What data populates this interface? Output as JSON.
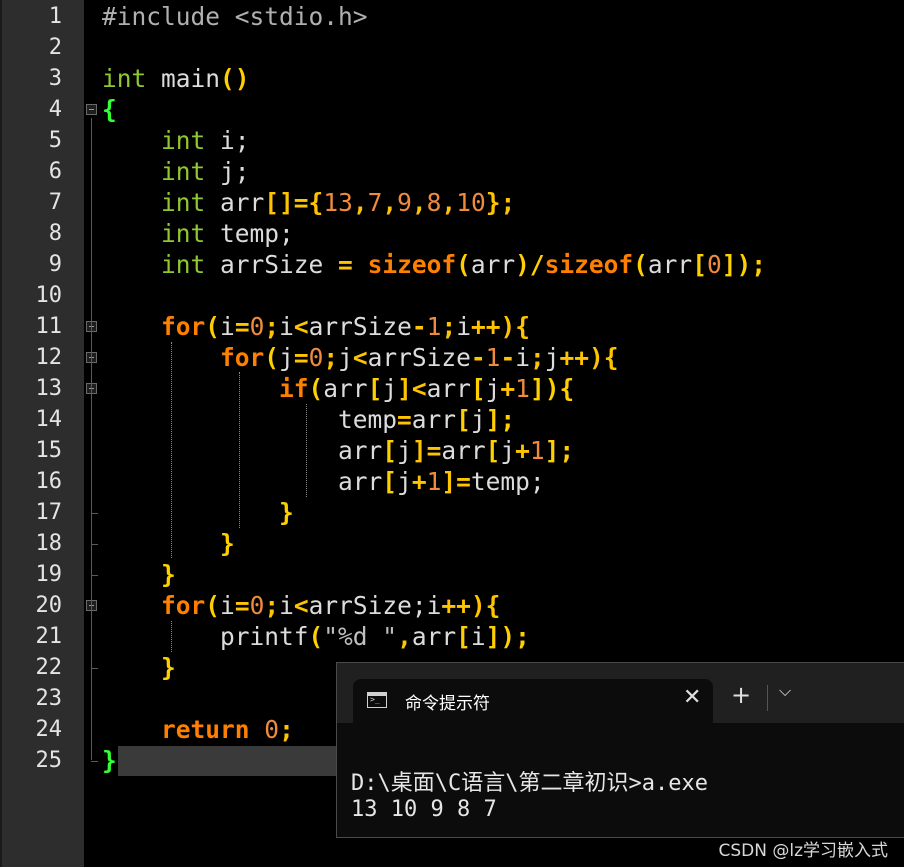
{
  "editor": {
    "line_numbers": [
      "1",
      "2",
      "3",
      "4",
      "5",
      "6",
      "7",
      "8",
      "9",
      "10",
      "11",
      "12",
      "13",
      "14",
      "15",
      "16",
      "17",
      "18",
      "19",
      "20",
      "21",
      "22",
      "23",
      "24",
      "25"
    ],
    "lines": [
      [
        {
          "t": "#include <stdio.h>",
          "c": "pre"
        }
      ],
      [],
      [
        {
          "t": "int",
          "c": "ty"
        },
        {
          "t": " main",
          "c": "id"
        },
        {
          "t": "()",
          "c": "br"
        }
      ],
      [
        {
          "t": "{",
          "c": "brace"
        }
      ],
      [
        {
          "t": "    ",
          "c": "id"
        },
        {
          "t": "int",
          "c": "ty"
        },
        {
          "t": " i;",
          "c": "id"
        }
      ],
      [
        {
          "t": "    ",
          "c": "id"
        },
        {
          "t": "int",
          "c": "ty"
        },
        {
          "t": " j;",
          "c": "id"
        }
      ],
      [
        {
          "t": "    ",
          "c": "id"
        },
        {
          "t": "int",
          "c": "ty"
        },
        {
          "t": " arr",
          "c": "id"
        },
        {
          "t": "[]={",
          "c": "op"
        },
        {
          "t": "13",
          "c": "num"
        },
        {
          "t": ",",
          "c": "op"
        },
        {
          "t": "7",
          "c": "num"
        },
        {
          "t": ",",
          "c": "op"
        },
        {
          "t": "9",
          "c": "num"
        },
        {
          "t": ",",
          "c": "op"
        },
        {
          "t": "8",
          "c": "num"
        },
        {
          "t": ",",
          "c": "op"
        },
        {
          "t": "10",
          "c": "num"
        },
        {
          "t": "};",
          "c": "op"
        }
      ],
      [
        {
          "t": "    ",
          "c": "id"
        },
        {
          "t": "int",
          "c": "ty"
        },
        {
          "t": " temp;",
          "c": "id"
        }
      ],
      [
        {
          "t": "    ",
          "c": "id"
        },
        {
          "t": "int",
          "c": "ty"
        },
        {
          "t": " arrSize ",
          "c": "id"
        },
        {
          "t": "=",
          "c": "op"
        },
        {
          "t": " ",
          "c": "id"
        },
        {
          "t": "sizeof",
          "c": "kw"
        },
        {
          "t": "(",
          "c": "br"
        },
        {
          "t": "arr",
          "c": "id"
        },
        {
          "t": ")/",
          "c": "br"
        },
        {
          "t": "sizeof",
          "c": "kw"
        },
        {
          "t": "(",
          "c": "br"
        },
        {
          "t": "arr",
          "c": "id"
        },
        {
          "t": "[",
          "c": "br"
        },
        {
          "t": "0",
          "c": "num"
        },
        {
          "t": "]);",
          "c": "br"
        }
      ],
      [],
      [
        {
          "t": "    ",
          "c": "id"
        },
        {
          "t": "for",
          "c": "kw"
        },
        {
          "t": "(",
          "c": "br"
        },
        {
          "t": "i",
          "c": "id"
        },
        {
          "t": "=",
          "c": "op"
        },
        {
          "t": "0",
          "c": "num"
        },
        {
          "t": ";",
          "c": "op"
        },
        {
          "t": "i",
          "c": "id"
        },
        {
          "t": "<",
          "c": "op"
        },
        {
          "t": "arrSize",
          "c": "id"
        },
        {
          "t": "-",
          "c": "op"
        },
        {
          "t": "1",
          "c": "num"
        },
        {
          "t": ";",
          "c": "op"
        },
        {
          "t": "i",
          "c": "id"
        },
        {
          "t": "++){",
          "c": "op"
        }
      ],
      [
        {
          "t": "        ",
          "c": "id"
        },
        {
          "t": "for",
          "c": "kw"
        },
        {
          "t": "(",
          "c": "br"
        },
        {
          "t": "j",
          "c": "id"
        },
        {
          "t": "=",
          "c": "op"
        },
        {
          "t": "0",
          "c": "num"
        },
        {
          "t": ";",
          "c": "op"
        },
        {
          "t": "j",
          "c": "id"
        },
        {
          "t": "<",
          "c": "op"
        },
        {
          "t": "arrSize",
          "c": "id"
        },
        {
          "t": "-",
          "c": "op"
        },
        {
          "t": "1",
          "c": "num"
        },
        {
          "t": "-",
          "c": "op"
        },
        {
          "t": "i",
          "c": "id"
        },
        {
          "t": ";",
          "c": "op"
        },
        {
          "t": "j",
          "c": "id"
        },
        {
          "t": "++){",
          "c": "op"
        }
      ],
      [
        {
          "t": "            ",
          "c": "id"
        },
        {
          "t": "if",
          "c": "kw"
        },
        {
          "t": "(",
          "c": "br"
        },
        {
          "t": "arr",
          "c": "id"
        },
        {
          "t": "[",
          "c": "br"
        },
        {
          "t": "j",
          "c": "id"
        },
        {
          "t": "]<",
          "c": "op"
        },
        {
          "t": "arr",
          "c": "id"
        },
        {
          "t": "[",
          "c": "br"
        },
        {
          "t": "j",
          "c": "id"
        },
        {
          "t": "+",
          "c": "op"
        },
        {
          "t": "1",
          "c": "num"
        },
        {
          "t": "]){",
          "c": "br"
        }
      ],
      [
        {
          "t": "                ",
          "c": "id"
        },
        {
          "t": "temp",
          "c": "id"
        },
        {
          "t": "=",
          "c": "op"
        },
        {
          "t": "arr",
          "c": "id"
        },
        {
          "t": "[",
          "c": "br"
        },
        {
          "t": "j",
          "c": "id"
        },
        {
          "t": "];",
          "c": "br"
        }
      ],
      [
        {
          "t": "                ",
          "c": "id"
        },
        {
          "t": "arr",
          "c": "id"
        },
        {
          "t": "[",
          "c": "br"
        },
        {
          "t": "j",
          "c": "id"
        },
        {
          "t": "]=",
          "c": "op"
        },
        {
          "t": "arr",
          "c": "id"
        },
        {
          "t": "[",
          "c": "br"
        },
        {
          "t": "j",
          "c": "id"
        },
        {
          "t": "+",
          "c": "op"
        },
        {
          "t": "1",
          "c": "num"
        },
        {
          "t": "];",
          "c": "br"
        }
      ],
      [
        {
          "t": "                ",
          "c": "id"
        },
        {
          "t": "arr",
          "c": "id"
        },
        {
          "t": "[",
          "c": "br"
        },
        {
          "t": "j",
          "c": "id"
        },
        {
          "t": "+",
          "c": "op"
        },
        {
          "t": "1",
          "c": "num"
        },
        {
          "t": "]=",
          "c": "op"
        },
        {
          "t": "temp;",
          "c": "id"
        }
      ],
      [
        {
          "t": "            ",
          "c": "id"
        },
        {
          "t": "}",
          "c": "br"
        }
      ],
      [
        {
          "t": "        ",
          "c": "id"
        },
        {
          "t": "}",
          "c": "br"
        }
      ],
      [
        {
          "t": "    ",
          "c": "id"
        },
        {
          "t": "}",
          "c": "br"
        }
      ],
      [
        {
          "t": "    ",
          "c": "id"
        },
        {
          "t": "for",
          "c": "kw"
        },
        {
          "t": "(",
          "c": "br"
        },
        {
          "t": "i",
          "c": "id"
        },
        {
          "t": "=",
          "c": "op"
        },
        {
          "t": "0",
          "c": "num"
        },
        {
          "t": ";",
          "c": "op"
        },
        {
          "t": "i",
          "c": "id"
        },
        {
          "t": "<",
          "c": "op"
        },
        {
          "t": "arrSize;i",
          "c": "id"
        },
        {
          "t": "++){",
          "c": "op"
        }
      ],
      [
        {
          "t": "        ",
          "c": "id"
        },
        {
          "t": "printf",
          "c": "id"
        },
        {
          "t": "(",
          "c": "br"
        },
        {
          "t": "\"%d \"",
          "c": "str"
        },
        {
          "t": ",",
          "c": "op"
        },
        {
          "t": "arr",
          "c": "id"
        },
        {
          "t": "[",
          "c": "br"
        },
        {
          "t": "i",
          "c": "id"
        },
        {
          "t": "]);",
          "c": "br"
        }
      ],
      [
        {
          "t": "    ",
          "c": "id"
        },
        {
          "t": "}",
          "c": "br"
        }
      ],
      [],
      [
        {
          "t": "    ",
          "c": "id"
        },
        {
          "t": "return",
          "c": "kw"
        },
        {
          "t": " ",
          "c": "id"
        },
        {
          "t": "0",
          "c": "num"
        },
        {
          "t": ";",
          "c": "op"
        }
      ],
      [
        {
          "t": "}",
          "c": "brace"
        }
      ]
    ]
  },
  "terminal": {
    "tab_title": "命令提示符",
    "close_icon": "✕",
    "new_tab_icon": "+",
    "dropdown_icon": "⌵",
    "prompt_line": "D:\\桌面\\C语言\\第二章初识>a.exe",
    "output_line": "13 10 9 8 7"
  },
  "watermark": "CSDN @lz学习嵌入式"
}
